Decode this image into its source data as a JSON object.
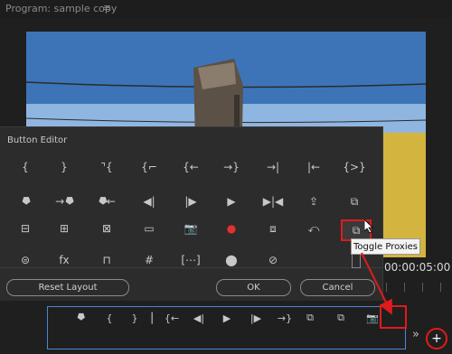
{
  "monitor": {
    "title": "Program: sample copy",
    "menu_glyph": "≡",
    "timecode": "00:00:05:00"
  },
  "dialog": {
    "title": "Button Editor",
    "buttons": [
      [
        "{",
        "}",
        "⌝{",
        "{⌐",
        "{←",
        "→}",
        "→|",
        "|←",
        "{>}"
      ],
      [
        "⯂",
        "→⯂",
        "⯂←",
        "◀|",
        "|▶",
        "▶",
        "▶|◀",
        "⇪",
        "⧉"
      ],
      [
        "⊟",
        "⊞",
        "⊠",
        "▭",
        "📷",
        "●",
        "⧈",
        "⤺",
        "⧉"
      ],
      [
        "⊜",
        "fx",
        "⊓",
        "#",
        "[⋯]",
        "⬤",
        "⊘",
        "",
        ""
      ]
    ],
    "reset_label": "Reset Layout",
    "ok_label": "OK",
    "cancel_label": "Cancel"
  },
  "tooltip": "Toggle Proxies",
  "bar": {
    "buttons": [
      "⯂",
      "{",
      "}",
      "▏",
      "{←",
      "◀|",
      "▶",
      "|▶",
      "→}",
      "⧉",
      "⧉",
      "📷"
    ]
  },
  "controls": {
    "overflow_glyph": "»",
    "add_glyph": "+"
  },
  "colors": {
    "highlight": "#e01b1b",
    "bar_border": "#4a85d8",
    "record": "#e53030"
  }
}
